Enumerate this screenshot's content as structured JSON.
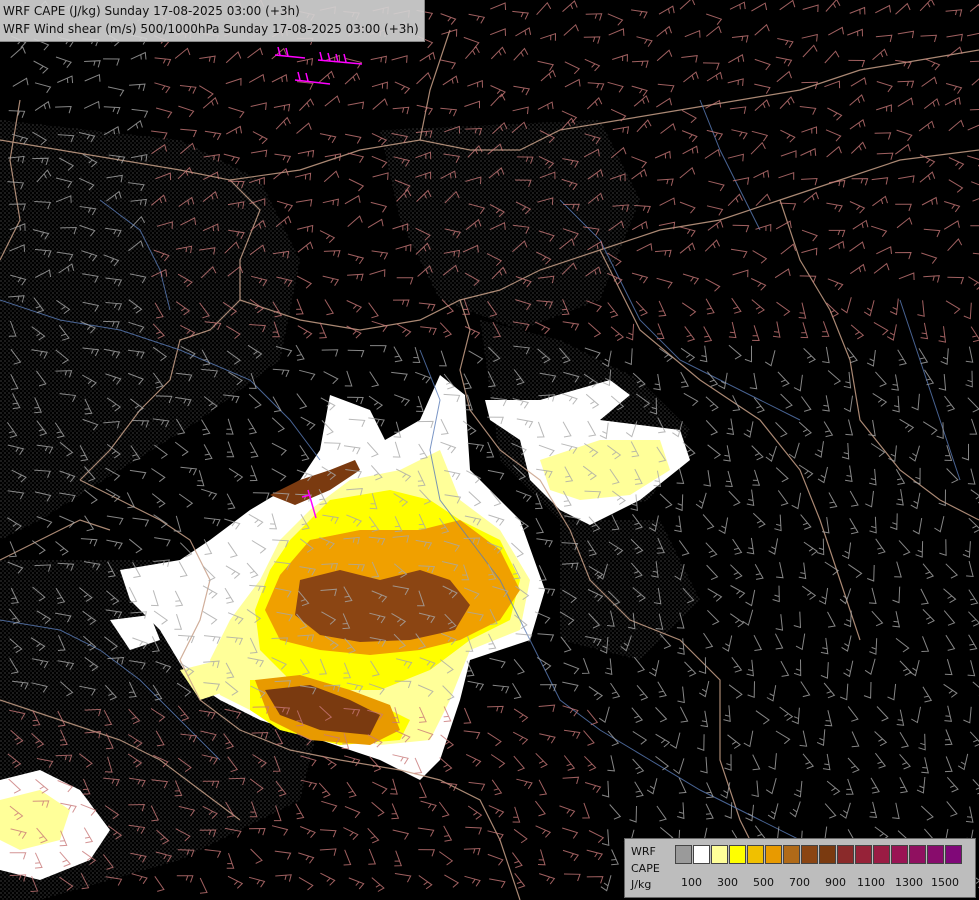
{
  "title_lines": [
    "WRF CAPE (J/kg) Sunday 17-08-2025 03:00 (+3h)",
    "WRF Wind shear (m/s) 500/1000hPa Sunday 17-08-2025 03:00 (+3h)"
  ],
  "legend": {
    "label_lines": [
      "WRF",
      "CAPE",
      "J/kg"
    ],
    "tick_labels": [
      "100",
      "300",
      "500",
      "700",
      "900",
      "1100",
      "1300",
      "1500"
    ],
    "colors": [
      "#9a9a9a",
      "#ffffff",
      "#ffff99",
      "#ffff00",
      "#f0c000",
      "#e89a00",
      "#b06a18",
      "#8b4513",
      "#7a3a10",
      "#8a2a2a",
      "#962238",
      "#9a1c44",
      "#9a1454",
      "#901060",
      "#880c6c",
      "#800878"
    ]
  },
  "map_colors": {
    "background": "#000000",
    "borders": "#c8a088",
    "rivers": "#5a7cb8",
    "barbs_low": "#a8a8a8",
    "barbs_high": "#c87878",
    "barbs_max": "#ff00ff"
  }
}
